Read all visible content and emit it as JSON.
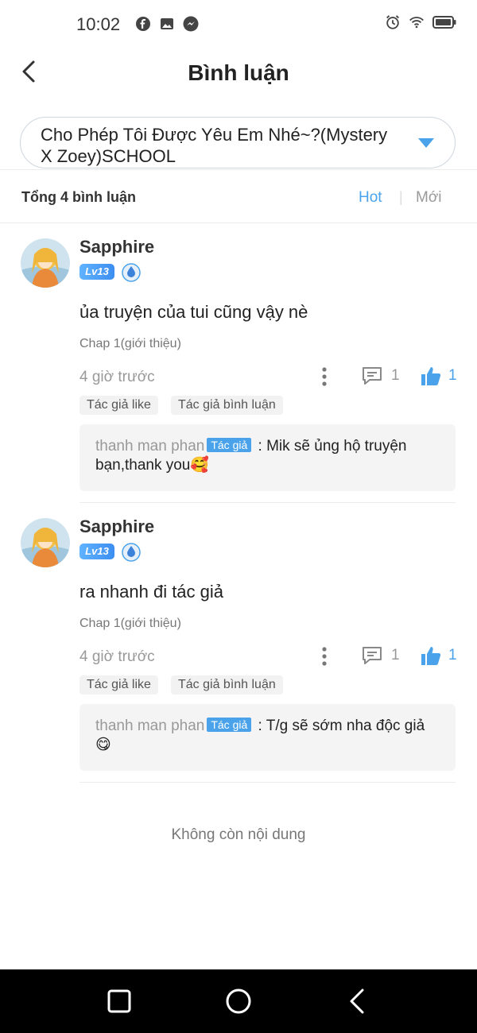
{
  "status_bar": {
    "time": "10:02",
    "left_icons": [
      "facebook-icon",
      "image-icon",
      "messenger-icon"
    ],
    "right_icons": [
      "alarm-icon",
      "wifi-icon",
      "battery-icon"
    ]
  },
  "header": {
    "title": "Bình luận",
    "back_icon": "chevron-left-icon"
  },
  "story_selector": {
    "value": "Cho Phép Tôi Được Yêu Em Nhé~?(Mystery X Zoey)SCHOOL",
    "dropdown_color": "#4aa3ea"
  },
  "summary": {
    "total": "Tổng 4 bình luận",
    "sort_hot": "Hot",
    "sort_separator": "|",
    "sort_new": "Mới"
  },
  "comments": [
    {
      "username": "Sapphire",
      "level": "Lv13",
      "text": "ủa truyện của tui cũng vậy nè",
      "chapter": "Chap 1(giới thiệu)",
      "time": "4 giờ trước",
      "reply_count": "1",
      "like_count": "1",
      "tags": [
        "Tác giả like",
        "Tác giả bình luận"
      ],
      "author_reply": {
        "author": "thanh man phan",
        "badge": "Tác giả",
        "separator": " : ",
        "text": "Mik sẽ ủng hộ truyện bạn,thank you🥰"
      }
    },
    {
      "username": "Sapphire",
      "level": "Lv13",
      "text": "ra nhanh đi tác giả",
      "chapter": "Chap 1(giới thiệu)",
      "time": "4 giờ trước",
      "reply_count": "1",
      "like_count": "1",
      "tags": [
        "Tác giả like",
        "Tác giả bình luận"
      ],
      "author_reply": {
        "author": "thanh man phan",
        "badge": "Tác giả",
        "separator": " : ",
        "text": "T/g sẽ sớm nha độc giả😋"
      }
    }
  ],
  "end_text": "Không còn nội dung",
  "colors": {
    "accent": "#4aa3ea",
    "muted": "#999999",
    "navbar": "#000000"
  }
}
